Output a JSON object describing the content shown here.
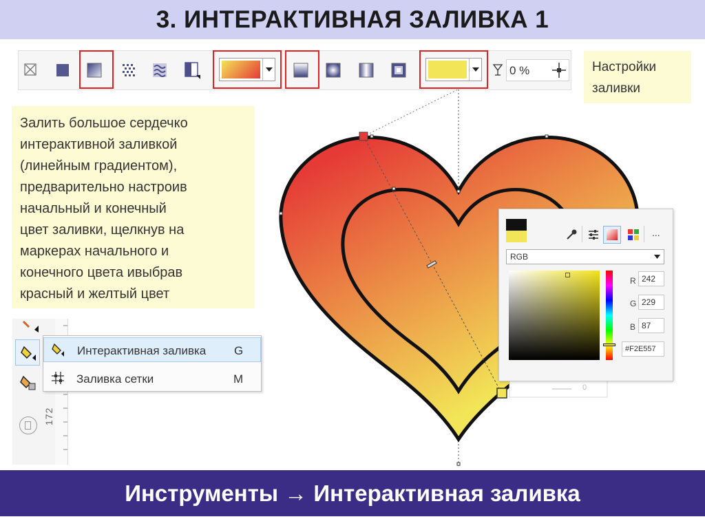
{
  "title": "3. ИНТЕРАКТИВНАЯ ЗАЛИВКА 1",
  "toolbar": {
    "transparency_value": "0 %",
    "start_color": "#e53a36",
    "end_color": "#f2e557"
  },
  "notes": {
    "settings": [
      "Настройки",
      "заливки"
    ],
    "instructions": [
      "Залить большое сердечко",
      "интерактивной заливкой",
      "(линейным градиентом),",
      "предварительно настроив",
      "начальный и конечный",
      "цвет заливки, щелкнув на",
      "маркерах начального и",
      "конечного цвета ивыбрав",
      "красный и желтый цвет"
    ]
  },
  "context_menu": {
    "items": [
      {
        "label": "Интерактивная заливка",
        "shortcut": "G"
      },
      {
        "label": "Заливка сетки",
        "shortcut": "M"
      }
    ]
  },
  "ruler_labels": [
    "172"
  ],
  "color_picker": {
    "model": "RGB",
    "channels": [
      {
        "label": "R",
        "value": "242"
      },
      {
        "label": "G",
        "value": "229"
      },
      {
        "label": "B",
        "value": "87"
      }
    ],
    "hex": "#F2E557",
    "more": "...",
    "under_value": "0"
  },
  "footer": "Инструменты → Интерактивная заливка"
}
